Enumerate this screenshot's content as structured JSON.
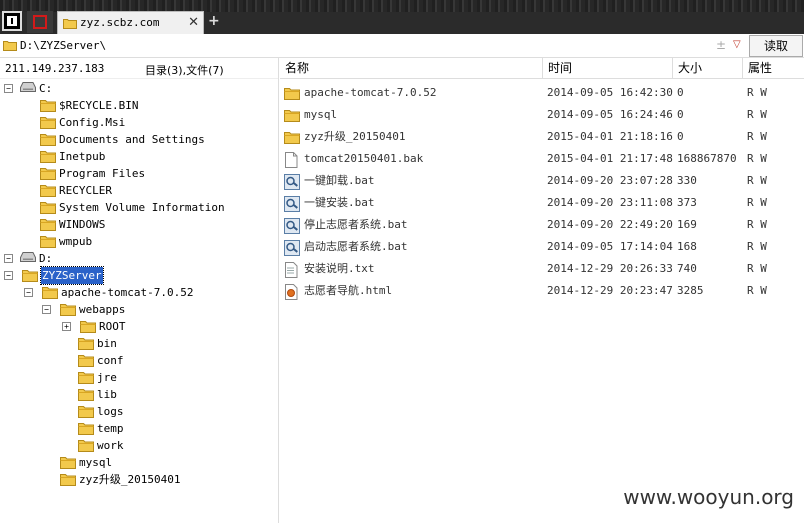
{
  "tab": {
    "title": "zyz.scbz.com",
    "close_icon": "close-icon"
  },
  "new_tab_label": "+",
  "address": {
    "path": "D:\\ZYZServer\\",
    "read_button": "读取"
  },
  "left": {
    "ip": "211.149.237.183",
    "counts": "目录(3),文件(7)"
  },
  "tree": [
    {
      "label": "C:",
      "type": "drive",
      "expanded": true
    },
    {
      "label": "$RECYCLE.BIN",
      "type": "folder"
    },
    {
      "label": "Config.Msi",
      "type": "folder"
    },
    {
      "label": "Documents and Settings",
      "type": "folder"
    },
    {
      "label": "Inetpub",
      "type": "folder"
    },
    {
      "label": "Program Files",
      "type": "folder"
    },
    {
      "label": "RECYCLER",
      "type": "folder"
    },
    {
      "label": "System Volume Information",
      "type": "folder"
    },
    {
      "label": "WINDOWS",
      "type": "folder"
    },
    {
      "label": "wmpub",
      "type": "folder"
    },
    {
      "label": "D:",
      "type": "drive",
      "expanded": true
    },
    {
      "label": "ZYZServer",
      "type": "folder",
      "expanded": true,
      "selected": true
    },
    {
      "label": "apache-tomcat-7.0.52",
      "type": "folder",
      "expanded": true
    },
    {
      "label": "webapps",
      "type": "folder",
      "expanded": true
    },
    {
      "label": "ROOT",
      "type": "folder",
      "expanded": false
    },
    {
      "label": "bin",
      "type": "folder"
    },
    {
      "label": "conf",
      "type": "folder"
    },
    {
      "label": "jre",
      "type": "folder"
    },
    {
      "label": "lib",
      "type": "folder"
    },
    {
      "label": "logs",
      "type": "folder"
    },
    {
      "label": "temp",
      "type": "folder"
    },
    {
      "label": "work",
      "type": "folder"
    },
    {
      "label": "mysql",
      "type": "folder"
    },
    {
      "label": "zyz升级_20150401",
      "type": "folder"
    }
  ],
  "columns": {
    "name": "名称",
    "time": "时间",
    "size": "大小",
    "attr": "属性"
  },
  "files": [
    {
      "name": "apache-tomcat-7.0.52",
      "time": "2014-09-05 16:42:30",
      "size": "0",
      "attr": "R W",
      "icon": "folder"
    },
    {
      "name": "mysql",
      "time": "2014-09-05 16:24:46",
      "size": "0",
      "attr": "R W",
      "icon": "folder"
    },
    {
      "name": "zyz升级_20150401",
      "time": "2015-04-01 21:18:16",
      "size": "0",
      "attr": "R W",
      "icon": "folder"
    },
    {
      "name": "tomcat20150401.bak",
      "time": "2015-04-01 21:17:48",
      "size": "168867870",
      "attr": "R W",
      "icon": "file"
    },
    {
      "name": "一键卸载.bat",
      "time": "2014-09-20 23:07:28",
      "size": "330",
      "attr": "R W",
      "icon": "bat"
    },
    {
      "name": "一键安装.bat",
      "time": "2014-09-20 23:11:08",
      "size": "373",
      "attr": "R W",
      "icon": "bat"
    },
    {
      "name": "停止志愿者系统.bat",
      "time": "2014-09-20 22:49:20",
      "size": "169",
      "attr": "R W",
      "icon": "bat"
    },
    {
      "name": "启动志愿者系统.bat",
      "time": "2014-09-05 17:14:04",
      "size": "168",
      "attr": "R W",
      "icon": "bat"
    },
    {
      "name": "安装说明.txt",
      "time": "2014-12-29 20:26:33",
      "size": "740",
      "attr": "R W",
      "icon": "txt"
    },
    {
      "name": "志愿者导航.html",
      "time": "2014-12-29 20:23:47",
      "size": "3285",
      "attr": "R W",
      "icon": "html"
    }
  ],
  "watermark": "www.wooyun.org",
  "colors": {
    "selection": "#2a62c9",
    "folder": "#f2c94c",
    "titlebar": "#2b2b2b"
  }
}
